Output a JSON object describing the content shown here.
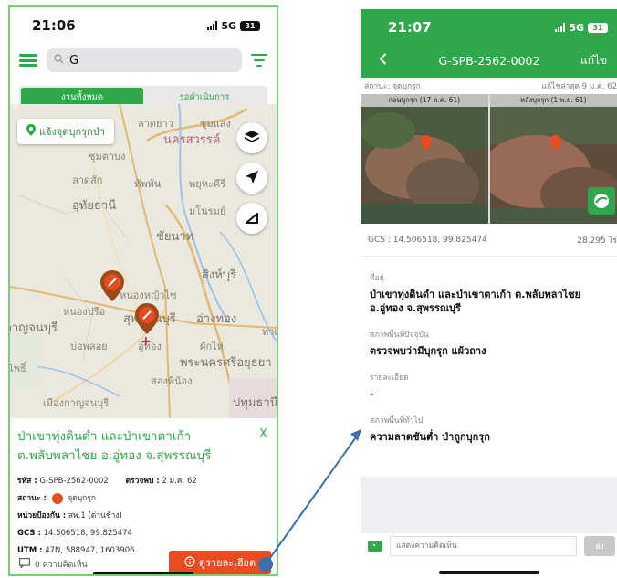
{
  "left": {
    "status_time": "21:06",
    "status_network": "5G",
    "status_battery": "31",
    "search_value": "G",
    "tabs": [
      {
        "label": "งานทั้งหมด",
        "active": true
      },
      {
        "label": "รอดำเนินการ",
        "active": false
      }
    ],
    "report_button": "แจ้งจุดบุกรุกป่า",
    "map_labels": [
      "นครสวรรค์",
      "ลาดยาว",
      "ชุมตาบง",
      "ลาดสัก",
      "ทัพทัน",
      "พยุหะคีรี",
      "อุทัยธานี",
      "มโนรมย์",
      "ชัยนาท",
      "สิงห์บุรี",
      "หนองหญ้าไซ",
      "หนองปรือ",
      "สุพรรณบุรี",
      "อ่างทอง",
      "บ่อพลอย",
      "อู่ทอง",
      "ผักไห่",
      "พระนครศรีอยุธยา",
      "สองพี่น้อง",
      "เมืองกาญจนบุรี",
      "ชุมแสง",
      "ปทุมธานี",
      "กาญจนบุรี",
      "โพธิ์",
      "ท่าเรือ"
    ],
    "place_title": "ป่าเขาทุ่งดินดำ และป่าเขาตาเก้า ต.พลับพลาไชย อ.อู่ทอง จ.สุพรรณบุรี",
    "close_label": "X",
    "code_label": "รหัส :",
    "code_value": "G-SPB-2562-0002",
    "inspect_label": "ตรวจพบ :",
    "inspect_value": "2 ม.ค. 62",
    "state_label": "สถานะ :",
    "state_value": "จุดบุกรุก",
    "unit_label": "หน่วยป้องกัน :",
    "unit_value": "สพ.1 (ด่านช้าง)",
    "gcs_label": "GCS :",
    "gcs_value": "14.506518, 99.825474",
    "utm_label": "UTM :",
    "utm_value": "47N, 588947, 1603906",
    "comments": "0 ความคิดเห็น",
    "view_detail": "ดูรายละเอียด"
  },
  "right": {
    "status_time": "21:07",
    "status_network": "5G",
    "status_battery": "31",
    "nav_title": "G-SPB-2562-0002",
    "nav_edit": "แก้ไข",
    "status_text": "สถานะ: จุดบุกรุก",
    "last_edit": "แก้ไขล่าสุด 9 ม.ค. 62",
    "image_before_caption": "ก่อนบุกรุก (17 ต.ค. 61)",
    "image_after_caption": "หลังบุกรุก (1 พ.ย. 61)",
    "image_watermark": "sentinel",
    "gcs": "GCS : 14.506518, 99.825474",
    "area": "28.295 ไร่",
    "address_label": "ที่อยู่",
    "address_value": "ป่าเขาทุ่งดินดำ และป่าเขาตาเก้า ต.พลับพลาไชย อ.อู่ทอง จ.สุพรรณบุรี",
    "current_label": "สภาพพื้นที่ปัจจุบัน",
    "current_value": "ตรวจพบว่ามีบุกรุก แผ้วถาง",
    "detail_label": "รายละเอียด",
    "detail_value": "-",
    "general_label": "สภาพพื้นที่ทั่วไป",
    "general_value": "ความลาดชันต่ำ ป่าถูกบุกรุก",
    "comment_placeholder": "แสดงความคิดเห็น",
    "send_label": "ส่ง"
  },
  "colors": {
    "brand_green": "#2ea84a",
    "alert_orange": "#e84d22",
    "arrow_blue": "#3d6fa8"
  }
}
